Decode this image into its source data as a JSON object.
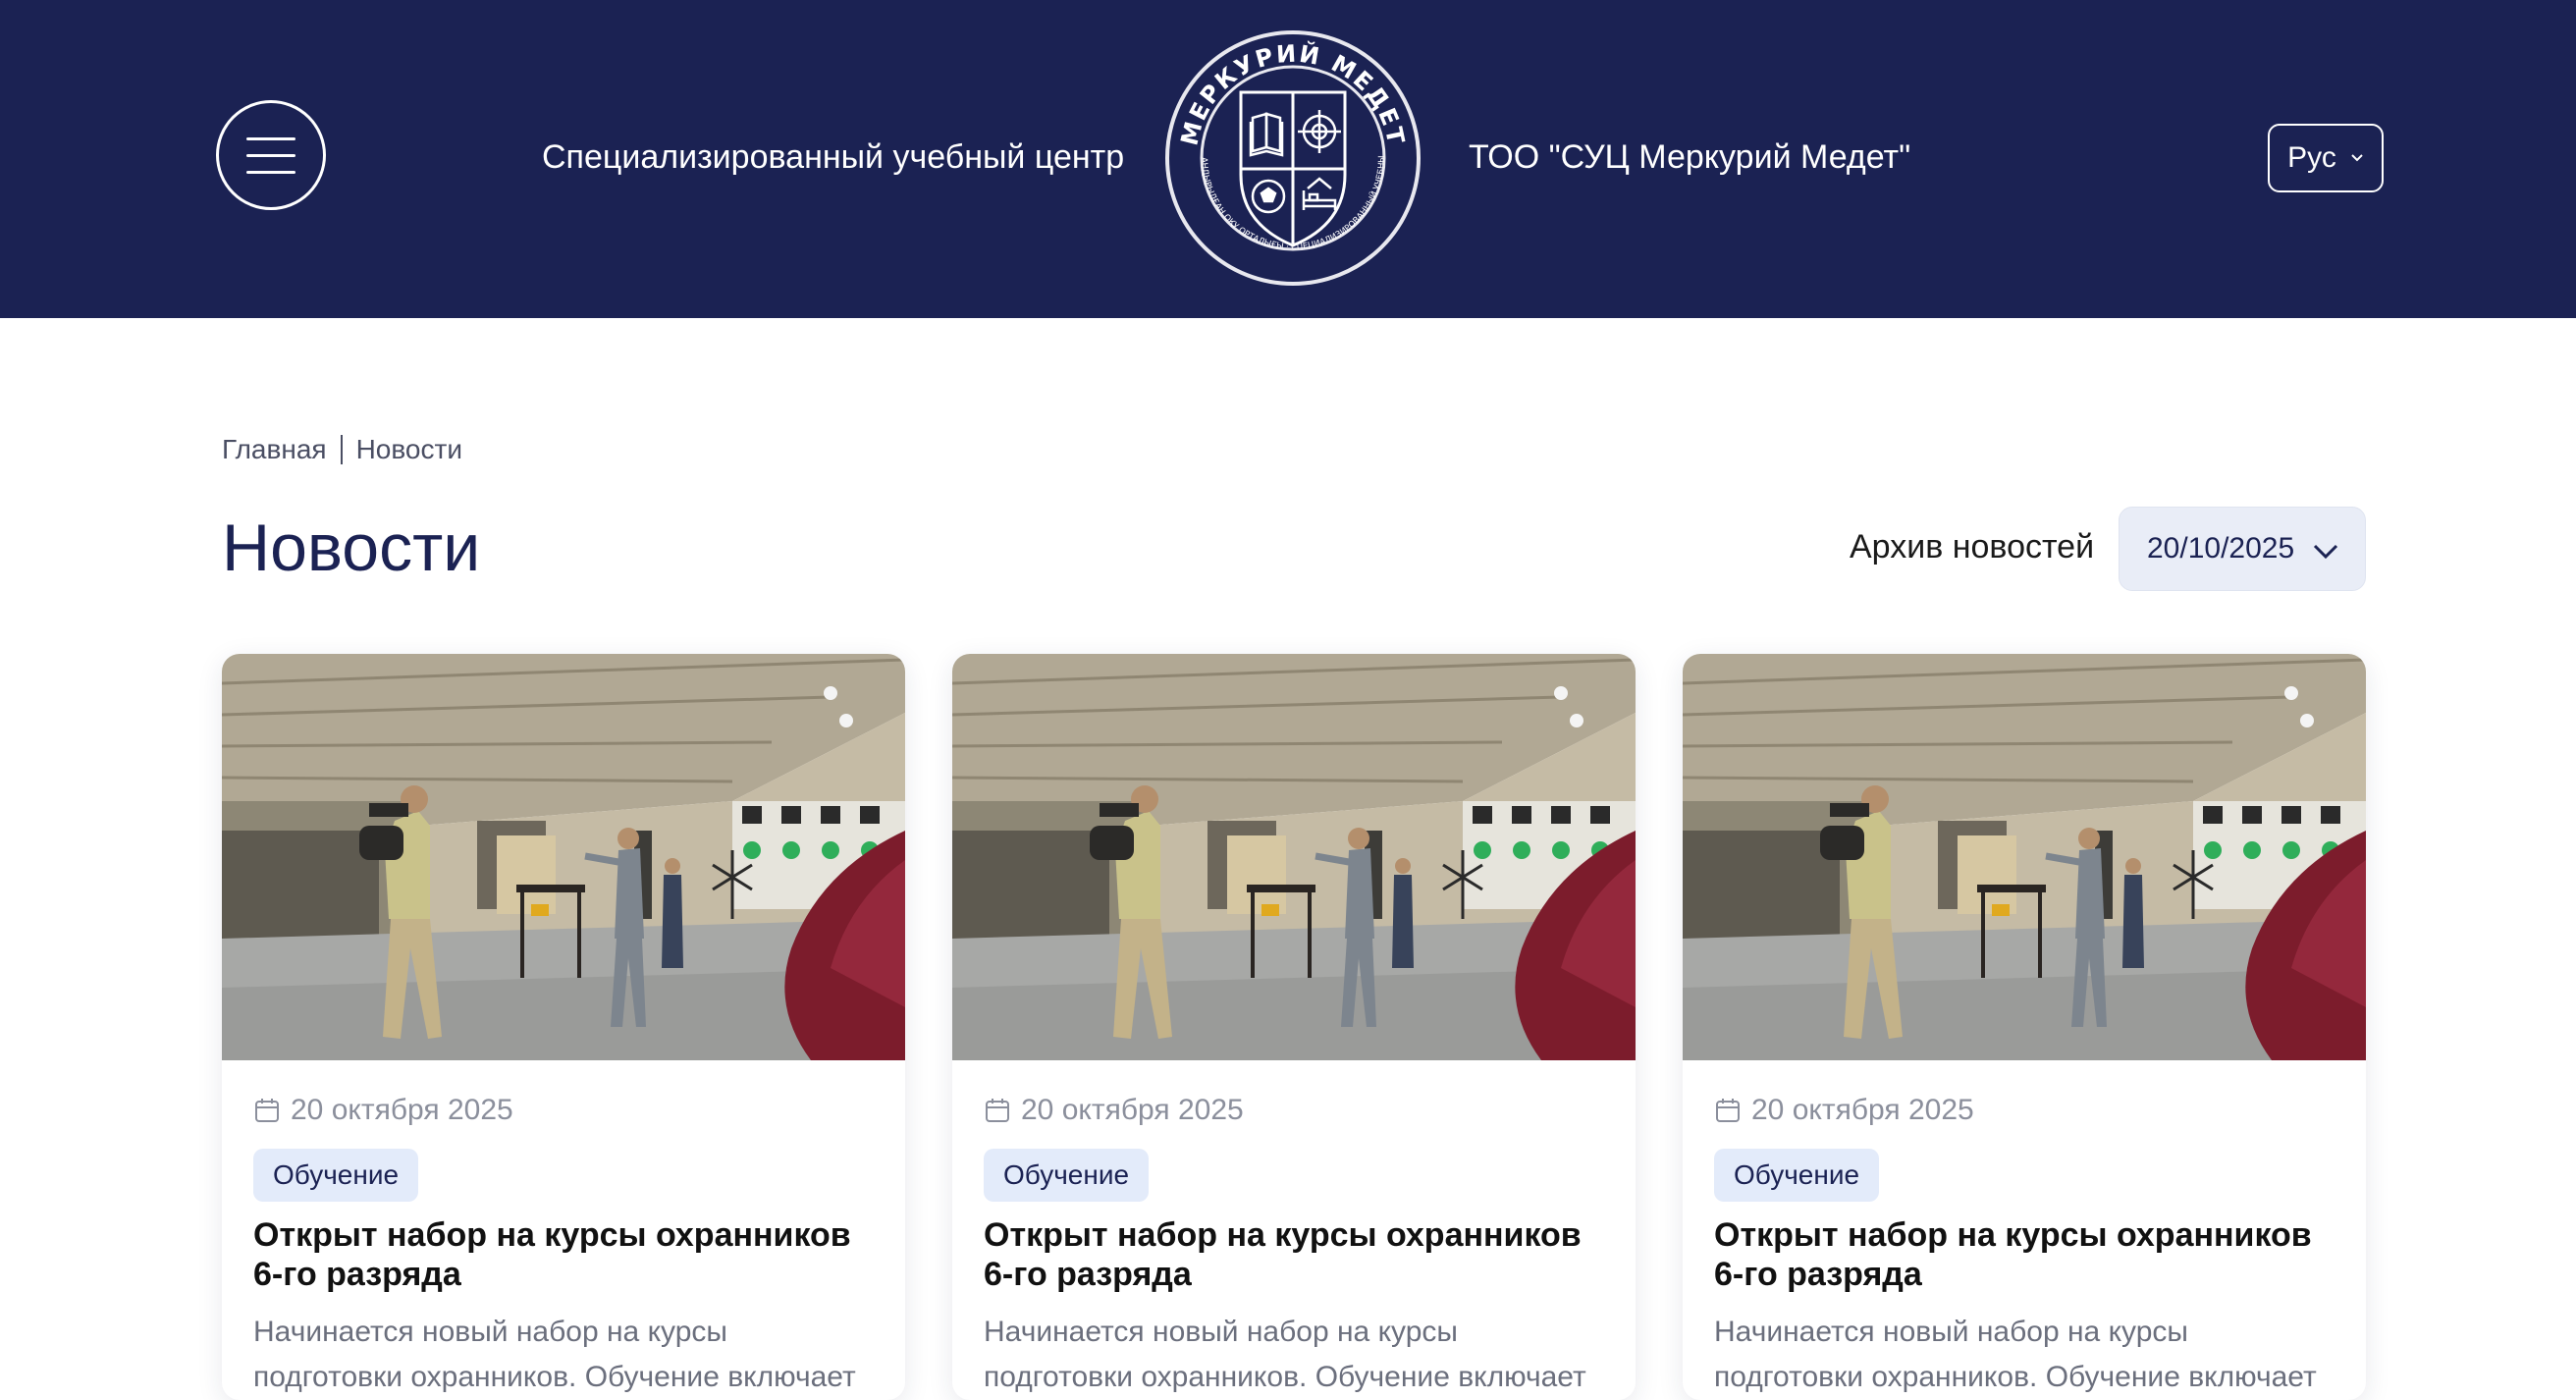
{
  "header": {
    "menu_icon": "hamburger-icon",
    "tagline_left": "Специализированный учебный центр",
    "tagline_right": "ТОО \"СУЦ Меркурий Медет\"",
    "logo": {
      "top_text": "МЕРКУРИЙ МЕДЕТ",
      "bottom_text": "МАМАНДАНДЫРЫЛҒАН ОҚУ ОРТАЛЫҒЫ · СПЕЦИАЛИЗИРОВАННЫЙ УЧЕБНЫЙ ЦЕНТР"
    },
    "language": "Рус",
    "colors": {
      "background": "#1b2253",
      "text": "#ffffff"
    }
  },
  "breadcrumb": {
    "items": [
      "Главная",
      "Новости"
    ]
  },
  "page": {
    "title": "Новости",
    "archive_label": "Архив новостей",
    "archive_value": "20/10/2025"
  },
  "cards": [
    {
      "image": "shooting-range-photo",
      "date": "20 октября 2025",
      "category": "Обучение",
      "title": "Открыт набор на курсы охранников 6-го разряда",
      "excerpt": "Начинается новый набор на курсы подготовки охранников. Обучение включает"
    },
    {
      "image": "shooting-range-photo",
      "date": "20 октября 2025",
      "category": "Обучение",
      "title": "Открыт набор на курсы охранников 6-го разряда",
      "excerpt": "Начинается новый набор на курсы подготовки охранников. Обучение включает"
    },
    {
      "image": "shooting-range-photo",
      "date": "20 октября 2025",
      "category": "Обучение",
      "title": "Открыт набор на курсы охранников 6-го разряда",
      "excerpt": "Начинается новый набор на курсы подготовки охранников. Обучение включает"
    }
  ],
  "colors": {
    "brand_navy": "#1b2253",
    "badge_bg": "#e3ebfa",
    "select_bg": "#e9edf7"
  }
}
